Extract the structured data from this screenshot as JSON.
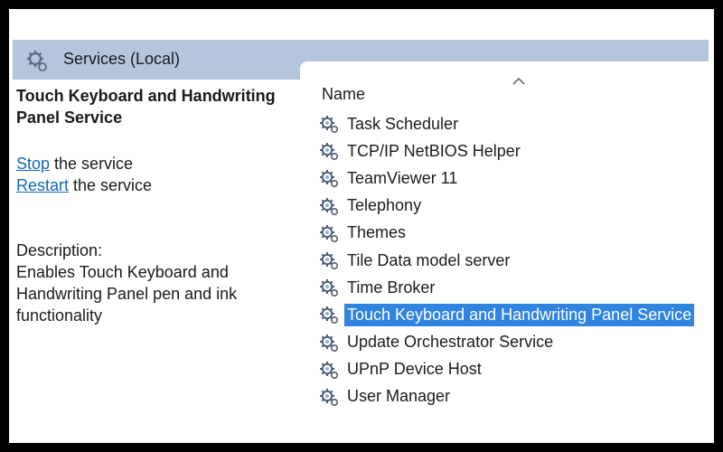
{
  "header": {
    "title": "Services (Local)",
    "icon": "services-gear-icon"
  },
  "details": {
    "service_name": "Touch Keyboard and Handwriting Panel Service",
    "actions": [
      {
        "link": "Stop",
        "rest": " the service"
      },
      {
        "link": "Restart",
        "rest": " the service"
      }
    ],
    "description_label": "Description:",
    "description_text": "Enables Touch Keyboard and Handwriting Panel pen and ink functionality"
  },
  "list": {
    "column_name": "Name",
    "sort_indicator": "ascending",
    "selected_index": 7,
    "selection_color": "#2f84e0",
    "rows": [
      "Task Scheduler",
      "TCP/IP NetBIOS Helper",
      "TeamViewer 11",
      "Telephony",
      "Themes",
      "Tile Data model server",
      "Time Broker",
      "Touch Keyboard and Handwriting Panel Service",
      "Update Orchestrator Service",
      "UPnP Device Host",
      "User Manager"
    ]
  },
  "colors": {
    "header_band": "#b3c6dc",
    "link": "#1566b5"
  }
}
